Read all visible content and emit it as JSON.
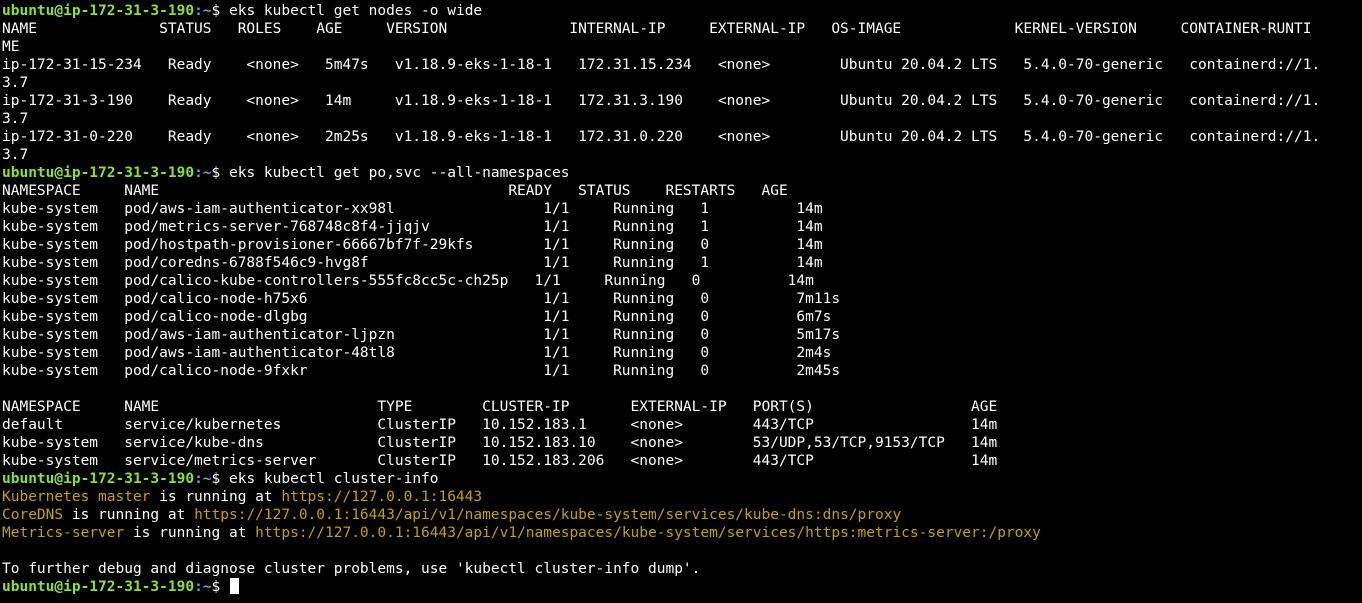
{
  "prompt": {
    "user_host": "ubuntu@ip-172-31-3-190",
    "path": ":~",
    "symbol": "$ "
  },
  "lines": [
    {
      "type": "prompt",
      "cmd": "eks kubectl get nodes -o wide"
    },
    {
      "type": "text",
      "text": "NAME              STATUS   ROLES    AGE     VERSION              INTERNAL-IP     EXTERNAL-IP   OS-IMAGE             KERNEL-VERSION     CONTAINER-RUNTI"
    },
    {
      "type": "text",
      "text": "ME"
    },
    {
      "type": "text",
      "text": "ip-172-31-15-234   Ready    <none>   5m47s   v1.18.9-eks-1-18-1   172.31.15.234   <none>        Ubuntu 20.04.2 LTS   5.4.0-70-generic   containerd://1."
    },
    {
      "type": "text",
      "text": "3.7"
    },
    {
      "type": "text",
      "text": "ip-172-31-3-190    Ready    <none>   14m     v1.18.9-eks-1-18-1   172.31.3.190    <none>        Ubuntu 20.04.2 LTS   5.4.0-70-generic   containerd://1."
    },
    {
      "type": "text",
      "text": "3.7"
    },
    {
      "type": "text",
      "text": "ip-172-31-0-220    Ready    <none>   2m25s   v1.18.9-eks-1-18-1   172.31.0.220    <none>        Ubuntu 20.04.2 LTS   5.4.0-70-generic   containerd://1."
    },
    {
      "type": "text",
      "text": "3.7"
    },
    {
      "type": "prompt",
      "cmd": "eks kubectl get po,svc --all-namespaces"
    },
    {
      "type": "text",
      "text": "NAMESPACE     NAME                                        READY   STATUS    RESTARTS   AGE"
    },
    {
      "type": "text",
      "text": "kube-system   pod/aws-iam-authenticator-xx98l                 1/1     Running   1          14m"
    },
    {
      "type": "text",
      "text": "kube-system   pod/metrics-server-768748c8f4-jjqjv             1/1     Running   1          14m"
    },
    {
      "type": "text",
      "text": "kube-system   pod/hostpath-provisioner-66667bf7f-29kfs        1/1     Running   0          14m"
    },
    {
      "type": "text",
      "text": "kube-system   pod/coredns-6788f546c9-hvg8f                    1/1     Running   1          14m"
    },
    {
      "type": "text",
      "text": "kube-system   pod/calico-kube-controllers-555fc8cc5c-ch25p   1/1     Running   0          14m"
    },
    {
      "type": "text",
      "text": "kube-system   pod/calico-node-h75x6                           1/1     Running   0          7m11s"
    },
    {
      "type": "text",
      "text": "kube-system   pod/calico-node-dlgbg                           1/1     Running   0          6m7s"
    },
    {
      "type": "text",
      "text": "kube-system   pod/aws-iam-authenticator-ljpzn                 1/1     Running   0          5m17s"
    },
    {
      "type": "text",
      "text": "kube-system   pod/aws-iam-authenticator-48tl8                 1/1     Running   0          2m4s"
    },
    {
      "type": "text",
      "text": "kube-system   pod/calico-node-9fxkr                           1/1     Running   0          2m45s"
    },
    {
      "type": "text",
      "text": ""
    },
    {
      "type": "text",
      "text": "NAMESPACE     NAME                         TYPE        CLUSTER-IP       EXTERNAL-IP   PORT(S)                  AGE"
    },
    {
      "type": "text",
      "text": "default       service/kubernetes           ClusterIP   10.152.183.1     <none>        443/TCP                  14m"
    },
    {
      "type": "text",
      "text": "kube-system   service/kube-dns             ClusterIP   10.152.183.10    <none>        53/UDP,53/TCP,9153/TCP   14m"
    },
    {
      "type": "text",
      "text": "kube-system   service/metrics-server       ClusterIP   10.152.183.206   <none>        443/TCP                  14m"
    },
    {
      "type": "prompt",
      "cmd": "eks kubectl cluster-info"
    },
    {
      "type": "info",
      "label": "Kubernetes master",
      "mid": " is running at ",
      "url": "https://127.0.0.1:16443"
    },
    {
      "type": "info",
      "label": "CoreDNS",
      "mid": " is running at ",
      "url": "https://127.0.0.1:16443/api/v1/namespaces/kube-system/services/kube-dns:dns/proxy"
    },
    {
      "type": "info",
      "label": "Metrics-server",
      "mid": " is running at ",
      "url": "https://127.0.0.1:16443/api/v1/namespaces/kube-system/services/https:metrics-server:/proxy"
    },
    {
      "type": "text",
      "text": ""
    },
    {
      "type": "text",
      "text": "To further debug and diagnose cluster problems, use 'kubectl cluster-info dump'."
    },
    {
      "type": "prompt_active",
      "cmd": ""
    }
  ],
  "colors": {
    "background": "#000000",
    "foreground": "#ffffff",
    "prompt_user": "#8ae234",
    "prompt_path": "#729fcf",
    "highlight": "#c4a000"
  }
}
